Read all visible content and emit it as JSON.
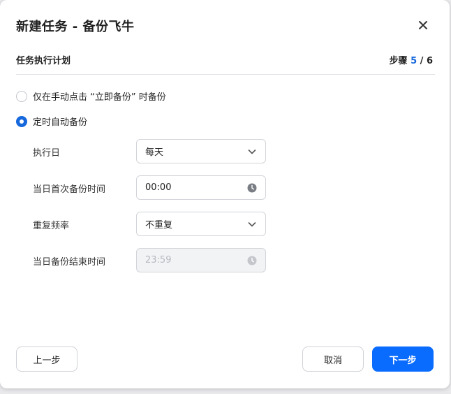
{
  "dialog": {
    "title": "新建任务 - 备份飞牛",
    "section_title": "任务执行计划",
    "step": {
      "label": "步骤",
      "current": "5",
      "separator": " / ",
      "total": "6"
    }
  },
  "schedule": {
    "options": [
      {
        "label": "仅在手动点击 “立即备份” 时备份",
        "checked": false
      },
      {
        "label": "定时自动备份",
        "checked": true
      }
    ]
  },
  "form": {
    "run_day": {
      "label": "执行日",
      "value": "每天"
    },
    "first_time": {
      "label": "当日首次备份时间",
      "value": "00:00"
    },
    "repeat": {
      "label": "重复频率",
      "value": "不重复"
    },
    "end_time": {
      "label": "当日备份结束时间",
      "value": "23:59",
      "disabled": true
    }
  },
  "footer": {
    "prev_label": "上一步",
    "cancel_label": "取消",
    "next_label": "下一步"
  },
  "colors": {
    "accent": "#0a6cff",
    "step_current": "#1668dc"
  },
  "icons": {
    "close": "close-icon",
    "chevron": "chevron-down-icon",
    "clock": "clock-icon"
  }
}
